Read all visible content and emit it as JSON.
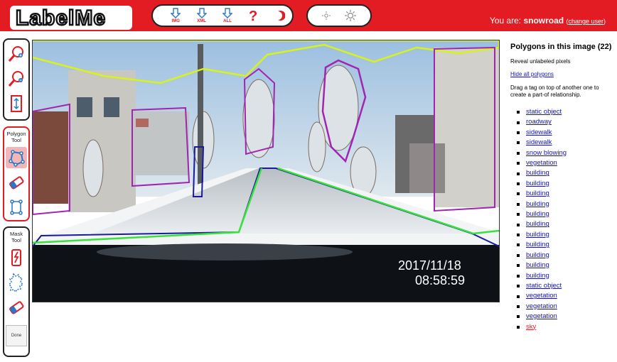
{
  "app": {
    "logo_text": "LabelMe",
    "colors": {
      "header": "#e31b23",
      "link": "#1414b8",
      "highlight": "#e31b23"
    }
  },
  "toolbar": {
    "buttons": [
      {
        "icon": "download-arrow-icon",
        "label": "IMG"
      },
      {
        "icon": "download-arrow-icon",
        "label": "XML"
      },
      {
        "icon": "download-arrow-icon",
        "label": "ALL"
      },
      {
        "icon": "help-question-icon",
        "label": ""
      },
      {
        "icon": "night-mode-moon-icon",
        "label": ""
      }
    ],
    "adjust": [
      {
        "icon": "brightness-low-icon"
      },
      {
        "icon": "brightness-high-icon"
      }
    ]
  },
  "user": {
    "prefix": "You are:",
    "name": "snowroad",
    "paren_open": "(",
    "change_label": "change user",
    "paren_close": ")"
  },
  "tools": {
    "polygon_title": [
      "Polygon",
      "Tool"
    ],
    "mask_title": [
      "Mask",
      "Tool"
    ],
    "done_label": "Done"
  },
  "image": {
    "date": "2017/11/18",
    "time": "08:58:59"
  },
  "panel": {
    "title": "Polygons in this image (22)",
    "reveal": "Reveal unlabeled pixels",
    "hide_all": "Hide all polygons",
    "instructions": "Drag a tag on top of another one to create a part-of relationship.",
    "polygons": [
      "static object",
      "roadway",
      "sidewalk",
      "sidewalk",
      "snow blowing",
      "vegetation",
      "building",
      "building",
      "building",
      "building",
      "building",
      "building",
      "building",
      "building",
      "building",
      "building",
      "building",
      "static object",
      "vegetation",
      "vegetation",
      "vegetation",
      "sky"
    ],
    "highlighted": "sky"
  }
}
